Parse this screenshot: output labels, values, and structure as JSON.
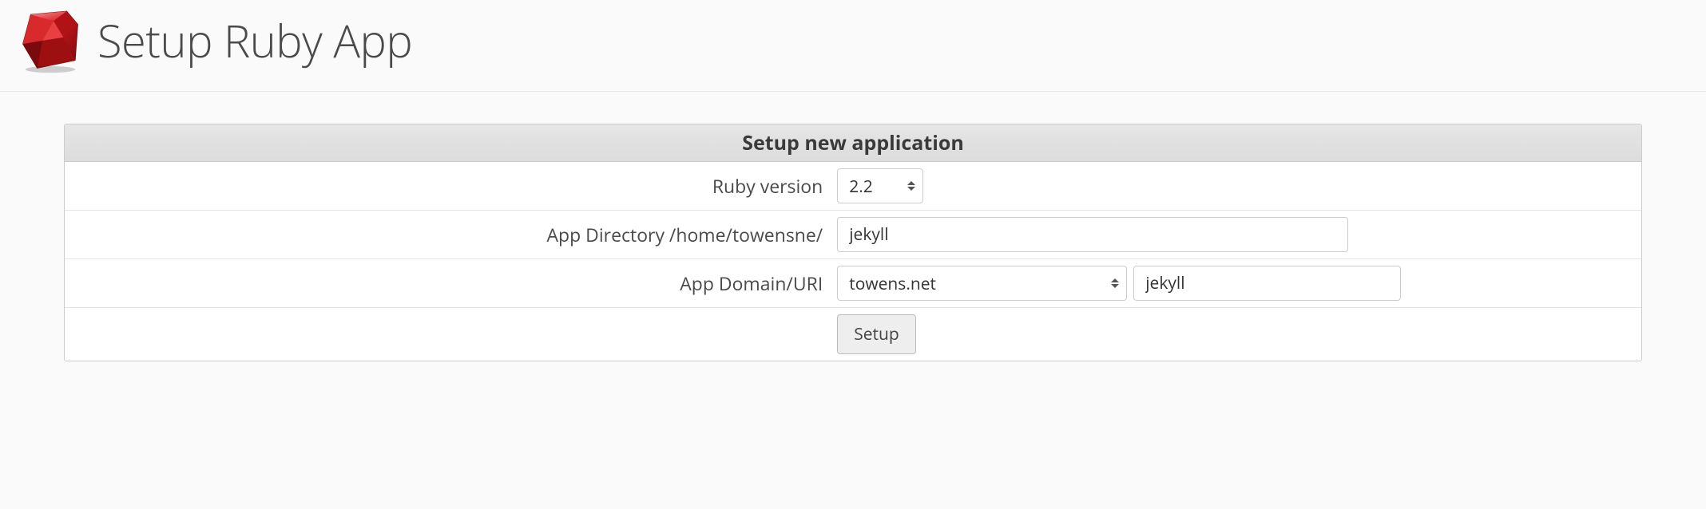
{
  "header": {
    "title": "Setup Ruby App"
  },
  "panel": {
    "title": "Setup new application",
    "rows": {
      "ruby_version": {
        "label": "Ruby version",
        "selected": "2.2"
      },
      "app_directory": {
        "label": "App Directory /home/towensne/",
        "value": "jekyll"
      },
      "app_domain": {
        "label": "App Domain/URI",
        "domain_selected": "towens.net",
        "uri_value": "jekyll"
      },
      "submit": {
        "label": "Setup"
      }
    }
  }
}
